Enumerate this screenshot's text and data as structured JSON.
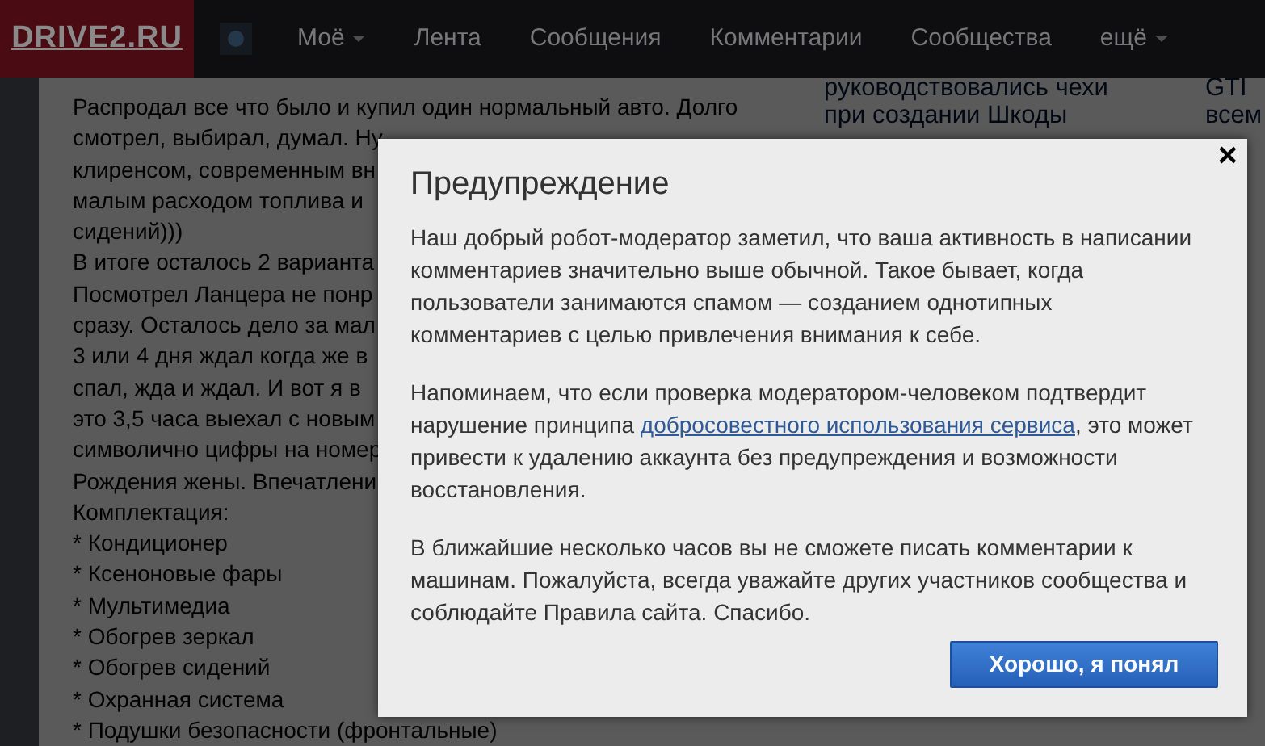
{
  "navbar": {
    "logo": "DRIVE2.RU",
    "items": [
      {
        "label": "Моё",
        "dropdown": true
      },
      {
        "label": "Лента",
        "dropdown": false
      },
      {
        "label": "Сообщения",
        "dropdown": false
      },
      {
        "label": "Комментарии",
        "dropdown": false
      },
      {
        "label": "Сообщества",
        "dropdown": false
      },
      {
        "label": "ещё",
        "dropdown": true
      }
    ]
  },
  "article": {
    "lines": [
      "Распродал все что было и купил один нормальный авто. Долго",
      "смотрел, выбирал, думал. Ну",
      "клиренсом, современным вн",
      "малым расходом топлива и",
      "сидений)))",
      "В итоге осталось 2 варианта",
      "Посмотрел Ланцера не понр",
      "сразу. Осталось дело за мал",
      "3 или 4 дня ждал когда же в",
      "спал, жда и ждал. И вот я в",
      "это 3,5 часа выехал с новым",
      "символично цифры на номер",
      "Рождения жены. Впечатлени",
      "Комплектация:",
      "* Кондиционер",
      "* Ксеноновые фары",
      "* Мультимедиа",
      "* Обогрев зеркал",
      "* Обогрев сидений",
      "* Охранная система",
      "* Подушки безопасности (фронтальные)"
    ]
  },
  "sidebar": {
    "column_1": [
      "руководствовались чехи",
      "при создании Шкоды"
    ],
    "column_2": [
      "GTI",
      "всем"
    ]
  },
  "modal": {
    "title": "Предупреждение",
    "close": "×",
    "paragraphs": [
      {
        "text": "Наш добрый робот-модератор заметил, что ваша активность в написании комментариев значительно выше обычной. Такое бывает, когда пользователи занимаются спамом — созданием однотипных комментариев с целью привлечения внимания к себе."
      },
      {
        "text": "Напоминаем, что если проверка модератором-человеком подтвердит нарушение принципа ",
        "link": "добросовестного использования сервиса",
        "text_after": ", это может привести к удалению аккаунта без предупреждения и возможности восстановления."
      },
      {
        "text": "В ближайшие несколько часов вы не сможете писать комментарии к машинам. Пожалуйста, всегда уважайте других участников сообщества и соблюдайте Правила сайта. Спасибо."
      }
    ],
    "button": "Хорошо, я понял"
  }
}
